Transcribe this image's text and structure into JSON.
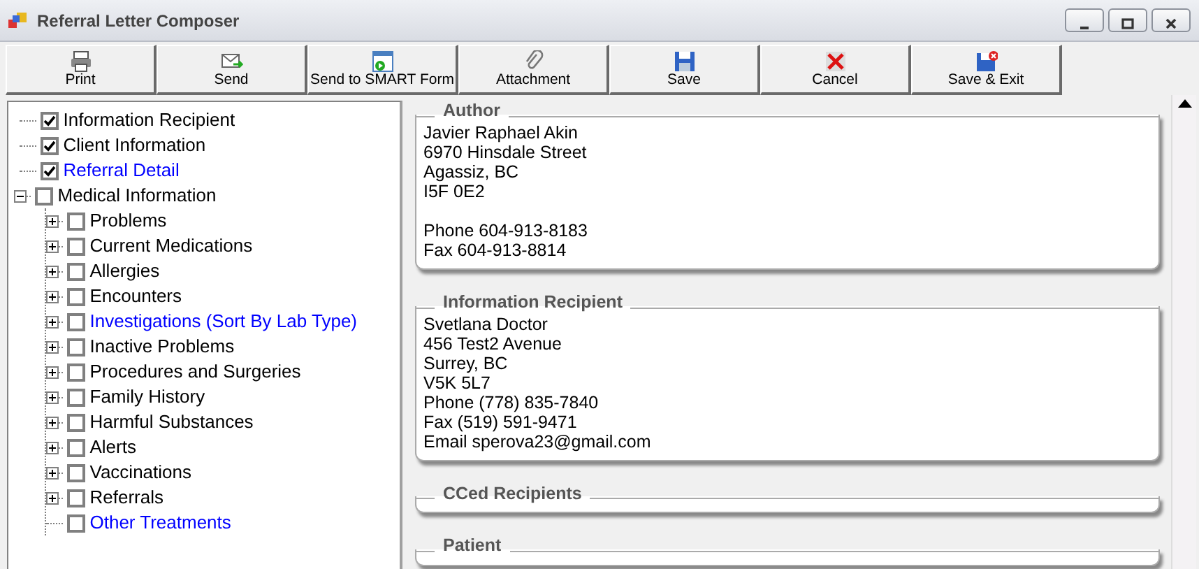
{
  "window": {
    "title": "Referral Letter Composer"
  },
  "toolbar": [
    {
      "label": "Print",
      "kind": "print"
    },
    {
      "label": "Send",
      "kind": "send"
    },
    {
      "label": "Send to SMART Form",
      "kind": "form"
    },
    {
      "label": "Attachment",
      "kind": "attach"
    },
    {
      "label": "Save",
      "kind": "save"
    },
    {
      "label": "Cancel",
      "kind": "cancel"
    },
    {
      "label": "Save & Exit",
      "kind": "saveexit"
    }
  ],
  "tree": [
    {
      "label": "Information Recipient",
      "kind": "leaf",
      "checked": true,
      "highlighted": false
    },
    {
      "label": "Client Information",
      "kind": "leaf",
      "checked": true,
      "highlighted": false
    },
    {
      "label": "Referral Detail",
      "kind": "leaf",
      "checked": true,
      "highlighted": true
    },
    {
      "label": "Medical Information",
      "kind": "group",
      "expanded": true,
      "checked": false,
      "highlighted": false,
      "children": [
        {
          "label": "Problems",
          "kind": "group",
          "expanded": false,
          "checked": false,
          "highlighted": false
        },
        {
          "label": "Current Medications",
          "kind": "group",
          "expanded": false,
          "checked": false,
          "highlighted": false
        },
        {
          "label": "Allergies",
          "kind": "group",
          "expanded": false,
          "checked": false,
          "highlighted": false
        },
        {
          "label": "Encounters",
          "kind": "group",
          "expanded": false,
          "checked": false,
          "highlighted": false
        },
        {
          "label": "Investigations (Sort By Lab Type)",
          "kind": "group",
          "expanded": false,
          "checked": false,
          "highlighted": true
        },
        {
          "label": "Inactive Problems",
          "kind": "group",
          "expanded": false,
          "checked": false,
          "highlighted": false
        },
        {
          "label": "Procedures and Surgeries",
          "kind": "group",
          "expanded": false,
          "checked": false,
          "highlighted": false
        },
        {
          "label": "Family History",
          "kind": "group",
          "expanded": false,
          "checked": false,
          "highlighted": false
        },
        {
          "label": "Harmful Substances",
          "kind": "group",
          "expanded": false,
          "checked": false,
          "highlighted": false
        },
        {
          "label": "Alerts",
          "kind": "group",
          "expanded": false,
          "checked": false,
          "highlighted": false
        },
        {
          "label": "Vaccinations",
          "kind": "group",
          "expanded": false,
          "checked": false,
          "highlighted": false
        },
        {
          "label": "Referrals",
          "kind": "group",
          "expanded": false,
          "checked": false,
          "highlighted": false
        },
        {
          "label": "Other Treatments",
          "kind": "leaf",
          "checked": false,
          "highlighted": true
        }
      ]
    }
  ],
  "sections": [
    {
      "title": "Author",
      "blocks": [
        [
          "Javier Raphael Akin",
          "6970 Hinsdale Street",
          "Agassiz, BC",
          "I5F 0E2"
        ],
        [
          "Phone 604-913-8183",
          "Fax 604-913-8814"
        ]
      ]
    },
    {
      "title": "Information Recipient",
      "blocks": [
        [
          "Svetlana Doctor",
          "456 Test2 Avenue",
          "Surrey, BC",
          "V5K 5L7",
          "Phone (778) 835-7840",
          "Fax (519) 591-9471",
          "Email sperova23@gmail.com"
        ]
      ]
    },
    {
      "title": "CCed Recipients"
    },
    {
      "title": "Patient"
    }
  ]
}
